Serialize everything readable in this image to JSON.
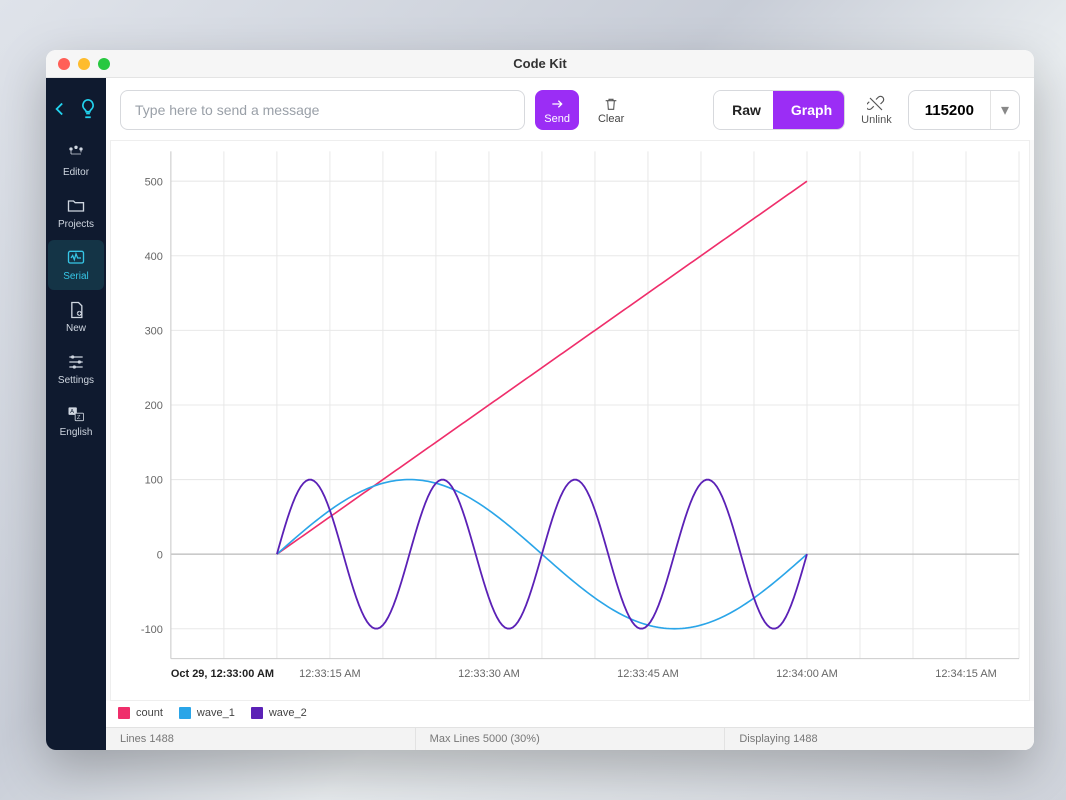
{
  "window": {
    "title": "Code Kit"
  },
  "sidebar": {
    "items": [
      {
        "id": "editor",
        "label": "Editor"
      },
      {
        "id": "projects",
        "label": "Projects"
      },
      {
        "id": "serial",
        "label": "Serial"
      },
      {
        "id": "new",
        "label": "New"
      },
      {
        "id": "settings",
        "label": "Settings"
      },
      {
        "id": "english",
        "label": "English"
      }
    ],
    "active": "serial"
  },
  "toolbar": {
    "message_placeholder": "Type here to send a message",
    "send_label": "Send",
    "clear_label": "Clear",
    "raw_label": "Raw",
    "graph_label": "Graph",
    "unlink_label": "Unlink",
    "baud_value": "115200"
  },
  "legend": {
    "series": [
      {
        "name": "count",
        "color": "#ef2e6b"
      },
      {
        "name": "wave_1",
        "color": "#2aa5e8"
      },
      {
        "name": "wave_2",
        "color": "#5b21b6"
      }
    ]
  },
  "status": {
    "lines": "Lines 1488",
    "maxlines": "Max Lines 5000 (30%)",
    "displaying": "Displaying 1488"
  },
  "chart_data": {
    "type": "line",
    "title": "",
    "xlabel": "",
    "ylabel": "",
    "ylim": [
      -140,
      540
    ],
    "x_start_label": "Oct 29, 12:33:00 AM",
    "x_tick_labels": [
      "12:33:15 AM",
      "12:33:30 AM",
      "12:33:45 AM",
      "12:34:00 AM",
      "12:34:15 AM"
    ],
    "x_domain_seconds": [
      0,
      80
    ],
    "data_t_range_seconds": [
      10,
      60
    ],
    "y_ticks": [
      -100,
      0,
      100,
      200,
      300,
      400,
      500
    ],
    "series": [
      {
        "name": "count",
        "formula": "linear t*10 from 0 to ~500 over 50s",
        "samples": [
          [
            10,
            0
          ],
          [
            60,
            500
          ]
        ]
      },
      {
        "name": "wave_1",
        "formula": "100*sin(2*pi*t/50)",
        "amplitude": 100,
        "period_s": 50,
        "phase_s": 0
      },
      {
        "name": "wave_2",
        "formula": "100*sin(2*pi*t/12.5)",
        "amplitude": 100,
        "period_s": 12.5,
        "phase_s": 0
      }
    ],
    "colors": {
      "count": "#ef2e6b",
      "wave_1": "#2aa5e8",
      "wave_2": "#5b21b6"
    }
  }
}
